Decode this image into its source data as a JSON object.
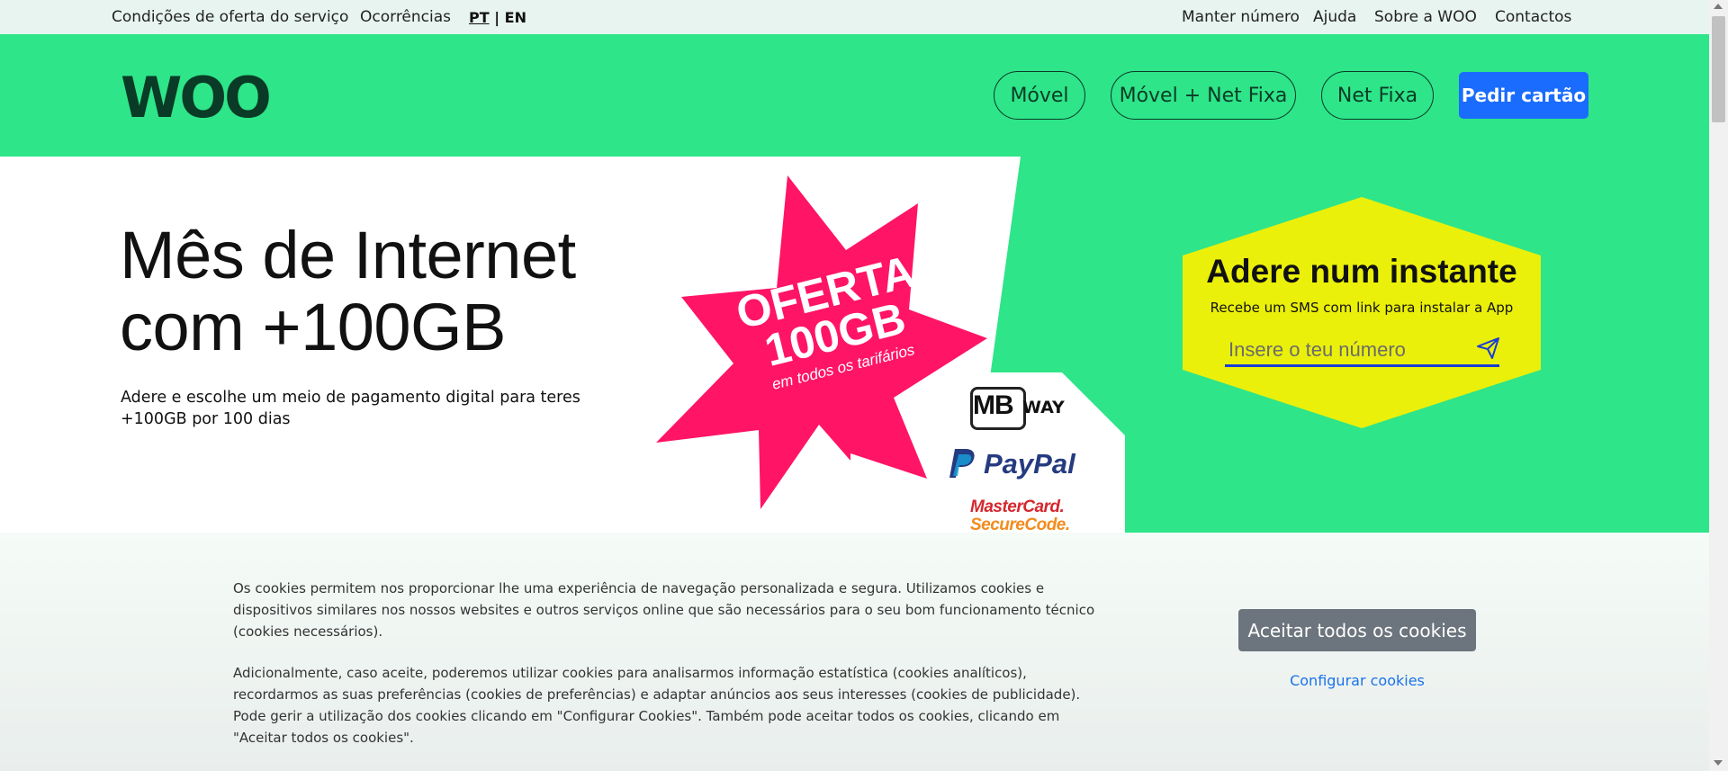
{
  "topbar": {
    "left_links": [
      "Condições de oferta do serviço",
      "Ocorrências"
    ],
    "lang_pt": "PT",
    "lang_sep": "|",
    "lang_en": "EN",
    "right_links": [
      "Manter número",
      "Ajuda",
      "Sobre a WOO",
      "Contactos"
    ]
  },
  "header": {
    "logo": "WOO",
    "nav": [
      "Móvel",
      "Móvel + Net Fixa",
      "Net Fixa"
    ],
    "cta": "Pedir cartão"
  },
  "hero": {
    "title_line1": "Mês de Internet",
    "title_line2": "com +100GB",
    "subtitle": "Adere e escolhe um meio de pagamento digital para teres +100GB por 100 dias",
    "badge_line1": "OFERTA",
    "badge_line2": "100GB",
    "badge_small": "em todos os tarifários",
    "payments": {
      "mbway_mb": "MB",
      "mbway_way": "WAY",
      "paypal": "PayPal",
      "mastercard_line1": "MasterCard.",
      "mastercard_line2": "SecureCode."
    }
  },
  "signup": {
    "title": "Adere num instante",
    "subtitle": "Recebe um SMS com link para instalar a App",
    "placeholder": "Insere o teu número"
  },
  "cookies": {
    "paragraph1": "Os cookies permitem nos proporcionar lhe uma experiência de navegação personalizada e segura. Utilizamos cookies e dispositivos similares nos nossos websites e outros serviços online que são necessários para o seu bom funcionamento técnico (cookies necessários).",
    "paragraph2": "Adicionalmente, caso aceite, poderemos utilizar cookies para analisarmos informação estatística (cookies analíticos), recordarmos as suas preferências (cookies de preferências) e adaptar anúncios aos seus interesses (cookies de publicidade). Pode gerir a utilização dos cookies clicando em \"Configurar Cookies\". Também pode aceitar todos os cookies, clicando em \"Aceitar todos os cookies\".",
    "accept": "Aceitar todos os cookies",
    "configure": "Configurar cookies"
  },
  "colors": {
    "brand_green": "#2ee589",
    "brand_dark": "#0a3b26",
    "cta_blue": "#1a6cff",
    "badge_pink": "#ff1466",
    "signup_yellow": "#eaf00a"
  }
}
